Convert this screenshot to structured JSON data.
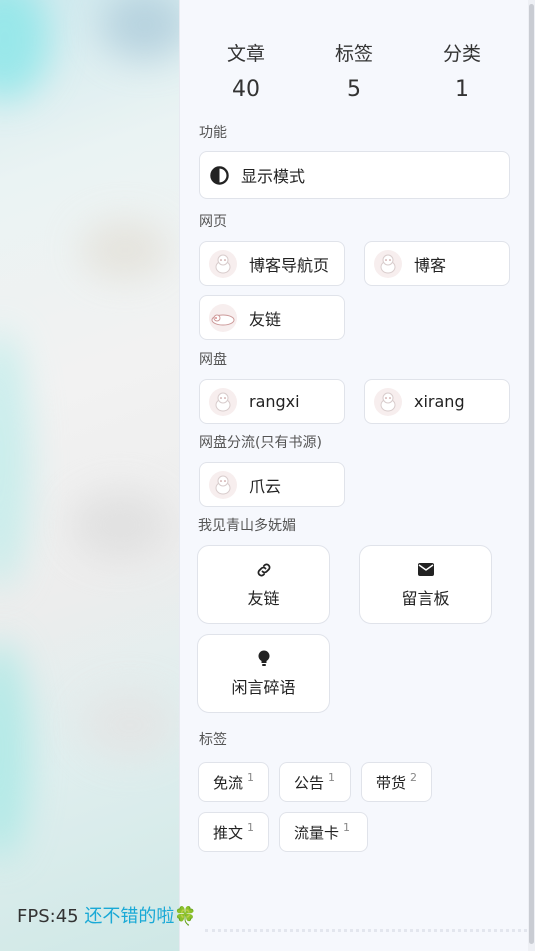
{
  "stats": [
    {
      "label": "文章",
      "value": "40"
    },
    {
      "label": "标签",
      "value": "5"
    },
    {
      "label": "分类",
      "value": "1"
    }
  ],
  "sections": {
    "function": "功能",
    "webpage": "网页",
    "netdisk": "网盘",
    "netdisk_split": "网盘分流(只有书源)",
    "qingshan": "我见青山多妩媚",
    "tags": "标签"
  },
  "function_items": {
    "display_mode": "显示模式"
  },
  "webpage_items": [
    "博客导航页",
    "博客",
    "友链"
  ],
  "netdisk_items": [
    "rangxi",
    "xirang"
  ],
  "netdisk_split_items": [
    "爪云"
  ],
  "qingshan_items": [
    "友链",
    "留言板",
    "闲言碎语"
  ],
  "tag_items": [
    {
      "name": "免流",
      "count": "1"
    },
    {
      "name": "公告",
      "count": "1"
    },
    {
      "name": "带货",
      "count": "2"
    },
    {
      "name": "推文",
      "count": "1"
    },
    {
      "name": "流量卡",
      "count": "1"
    }
  ],
  "fps": {
    "label": "FPS:45",
    "status": "还不错的啦🍀"
  },
  "colors": {
    "accent": "#19a9d6",
    "panel": "#f6f8fd",
    "card": "#ffffff",
    "border": "#e0e3ea"
  }
}
